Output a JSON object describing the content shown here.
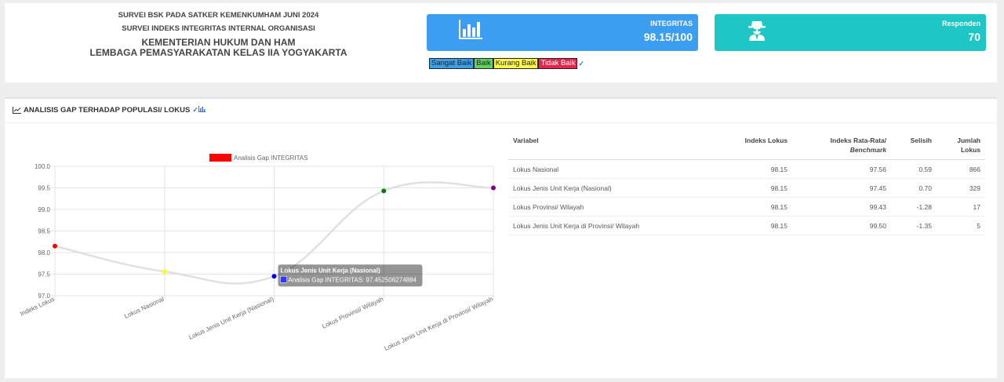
{
  "header": {
    "line1": "SURVEI BSK PADA SATKER KEMENKUMHAM JUNI 2024",
    "line2": "SURVEI INDEKS INTEGRITAS INTERNAL ORGANISASI",
    "line3": "KEMENTERIAN HUKUM DAN HAM",
    "line4": "LEMBAGA PEMASYARAKATAN KELAS IIA YOGYAKARTA"
  },
  "integritas_card": {
    "label": "INTEGRITAS",
    "value": "98.15/100",
    "color": "#3b9ef0",
    "icon": "bar-chart-icon"
  },
  "responden_card": {
    "label": "Responden",
    "value": "70",
    "color": "#1fc6c6",
    "icon": "user-secret-icon"
  },
  "legend_strip": {
    "sangat_baik": "Sangat Baik",
    "baik": "Baik",
    "kurang_baik": "Kurang Baik",
    "tidak_baik": "Tidak Baik"
  },
  "section": {
    "title": "ANALISIS GAP TERHADAP POPULASI/ LOKUS"
  },
  "chart_data": {
    "type": "line",
    "categories": [
      "Indeks Lokus",
      "Lokus Nasional",
      "Lokus Jenis Unit Kerja (Nasional)",
      "Lokus Provinsi/ Wilayah",
      "Lokus Jenis Unit Kerja di Provinsi/ Wilayah"
    ],
    "series": [
      {
        "name": "Analisis Gap INTEGRITAS",
        "values": [
          98.15,
          97.56,
          97.45,
          99.43,
          99.5
        ],
        "color": "#ff0000"
      }
    ],
    "point_colors": [
      "#ff0000",
      "#ffff00",
      "#0000ff",
      "#008000",
      "#800080"
    ],
    "yticks": [
      "100.0",
      "99.5",
      "99.0",
      "98.5",
      "98.0",
      "97.5",
      "97.0"
    ],
    "ylim": [
      97.0,
      100.0
    ],
    "tooltip": {
      "title": "Lokus Jenis Unit Kerja (Nasional)",
      "body": "Analisis Gap INTEGRITAS: 97.452506274884"
    }
  },
  "table": {
    "headers": {
      "variabel": "Variabel",
      "indeks_lokus": "Indeks Lokus",
      "rata_rata_1": "Indeks Rata-Rata/",
      "rata_rata_2": "Benchmark",
      "selisih": "Selisih",
      "jumlah_1": "Jumlah",
      "jumlah_2": "Lokus"
    },
    "rows": [
      {
        "variabel": "Lokus Nasional",
        "indeks": "98.15",
        "rata": "97.56",
        "selisih": "0.59",
        "jumlah": "866"
      },
      {
        "variabel": "Lokus Jenis Unit Kerja (Nasional)",
        "indeks": "98.15",
        "rata": "97.45",
        "selisih": "0.70",
        "jumlah": "329"
      },
      {
        "variabel": "Lokus Provinsi/ Wilayah",
        "indeks": "98.15",
        "rata": "99.43",
        "selisih": "-1.28",
        "jumlah": "17"
      },
      {
        "variabel": "Lokus Jenis Unit Kerja di Provinsi/ Wilayah",
        "indeks": "98.15",
        "rata": "99.50",
        "selisih": "-1.35",
        "jumlah": "5"
      }
    ]
  }
}
